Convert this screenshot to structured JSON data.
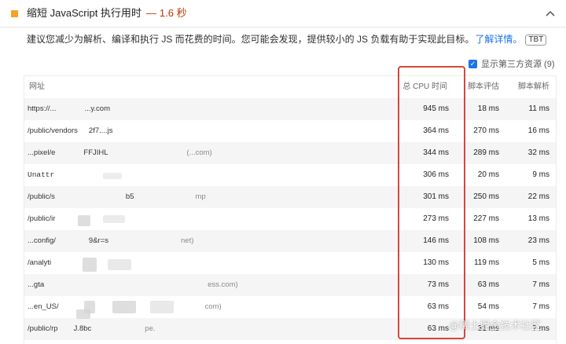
{
  "audit": {
    "title": "缩短 JavaScript 执行用时",
    "separator": "—",
    "value": "1.6 秒",
    "description": "建议您减少为解析、编译和执行 JS 而花费的时间。您可能会发现，提供较小的 JS 负载有助于实现此目标。",
    "learn_more": "了解详情。",
    "badge": "TBT",
    "status_color": "#f4a327",
    "value_color": "#c33300"
  },
  "third_party": {
    "label": "显示第三方资源 (9)",
    "checked": true
  },
  "table": {
    "headers": {
      "url": "网址",
      "cpu": "总 CPU 时间",
      "eval": "脚本评估",
      "parse": "脚本解析"
    },
    "rows": [
      {
        "url": "https://...",
        "url_tail": "...y.com",
        "cpu": "945 ms",
        "eval": "18 ms",
        "parse": "11 ms"
      },
      {
        "url": "/public/vendors",
        "url_tail": "2f7....js",
        "cpu": "364 ms",
        "eval": "270 ms",
        "parse": "16 ms"
      },
      {
        "url": "...pixel/e",
        "url_tail": "FFJIHL",
        "url_dim": "(...com)",
        "cpu": "344 ms",
        "eval": "289 ms",
        "parse": "32 ms"
      },
      {
        "url": "Unattr",
        "url_tail": "",
        "cpu": "306 ms",
        "eval": "20 ms",
        "parse": "9 ms"
      },
      {
        "url": "/public/s",
        "url_tail": "b5",
        "url_dim": "mp",
        "cpu": "301 ms",
        "eval": "250 ms",
        "parse": "22 ms"
      },
      {
        "url": "/public/ir",
        "url_tail": "",
        "cpu": "273 ms",
        "eval": "227 ms",
        "parse": "13 ms"
      },
      {
        "url": "...config/",
        "url_tail": "9&r=s",
        "url_dim": "net)",
        "cpu": "146 ms",
        "eval": "108 ms",
        "parse": "23 ms"
      },
      {
        "url": "/analyti",
        "url_tail": "",
        "cpu": "130 ms",
        "eval": "119 ms",
        "parse": "5 ms"
      },
      {
        "url": "...gta",
        "url_tail": "",
        "url_dim": "ess.com)",
        "cpu": "73 ms",
        "eval": "63 ms",
        "parse": "7 ms"
      },
      {
        "url": "...en_US/",
        "url_tail": "",
        "url_dim": "com)",
        "cpu": "63 ms",
        "eval": "54 ms",
        "parse": "7 ms"
      },
      {
        "url": "/public/rp",
        "url_tail": "J.8bc",
        "url_dim": "pe.",
        "cpu": "63 ms",
        "eval": "31 ms",
        "parse": "7 ms"
      }
    ]
  },
  "highlight_color": "#d9453b",
  "watermark": "@稀土掘金技术社区",
  "icons": {
    "status": "orange-square-icon",
    "expand": "chevron-up-icon",
    "checkbox": "checkbox-checked-icon"
  }
}
